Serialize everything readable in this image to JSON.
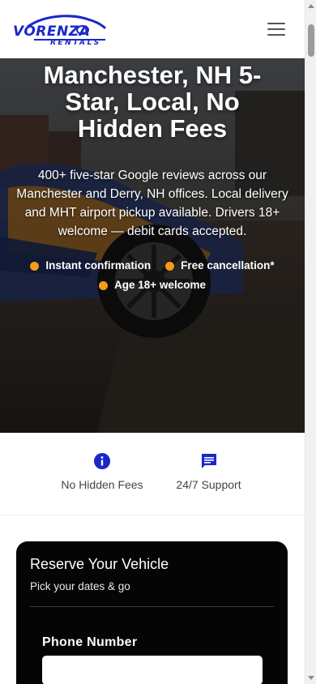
{
  "header": {
    "logo_text": "VORENZA",
    "logo_sub": "RENTALS",
    "menu_icon": "hamburger-menu-icon",
    "brand_color": "#1a28c8"
  },
  "hero": {
    "title": "Manchester, NH 5-Star, Local, No Hidden Fees",
    "description": "400+ five-star Google reviews across our Manchester and Derry, NH offices. Local delivery and MHT airport pickup available. Drivers 18+ welcome — debit cards accepted.",
    "features": [
      {
        "label": "Instant confirmation"
      },
      {
        "label": "Free cancellation*"
      },
      {
        "label": "Age 18+ welcome"
      }
    ],
    "accent_color": "#f59a1a"
  },
  "trust": [
    {
      "label": "No Hidden Fees",
      "icon": "info-icon"
    },
    {
      "label": "24/7 Support",
      "icon": "chat-icon"
    }
  ],
  "reserve": {
    "title": "Reserve Your Vehicle",
    "subtitle": "Pick your dates & go",
    "phone_label": "Phone Number",
    "phone_value": ""
  }
}
